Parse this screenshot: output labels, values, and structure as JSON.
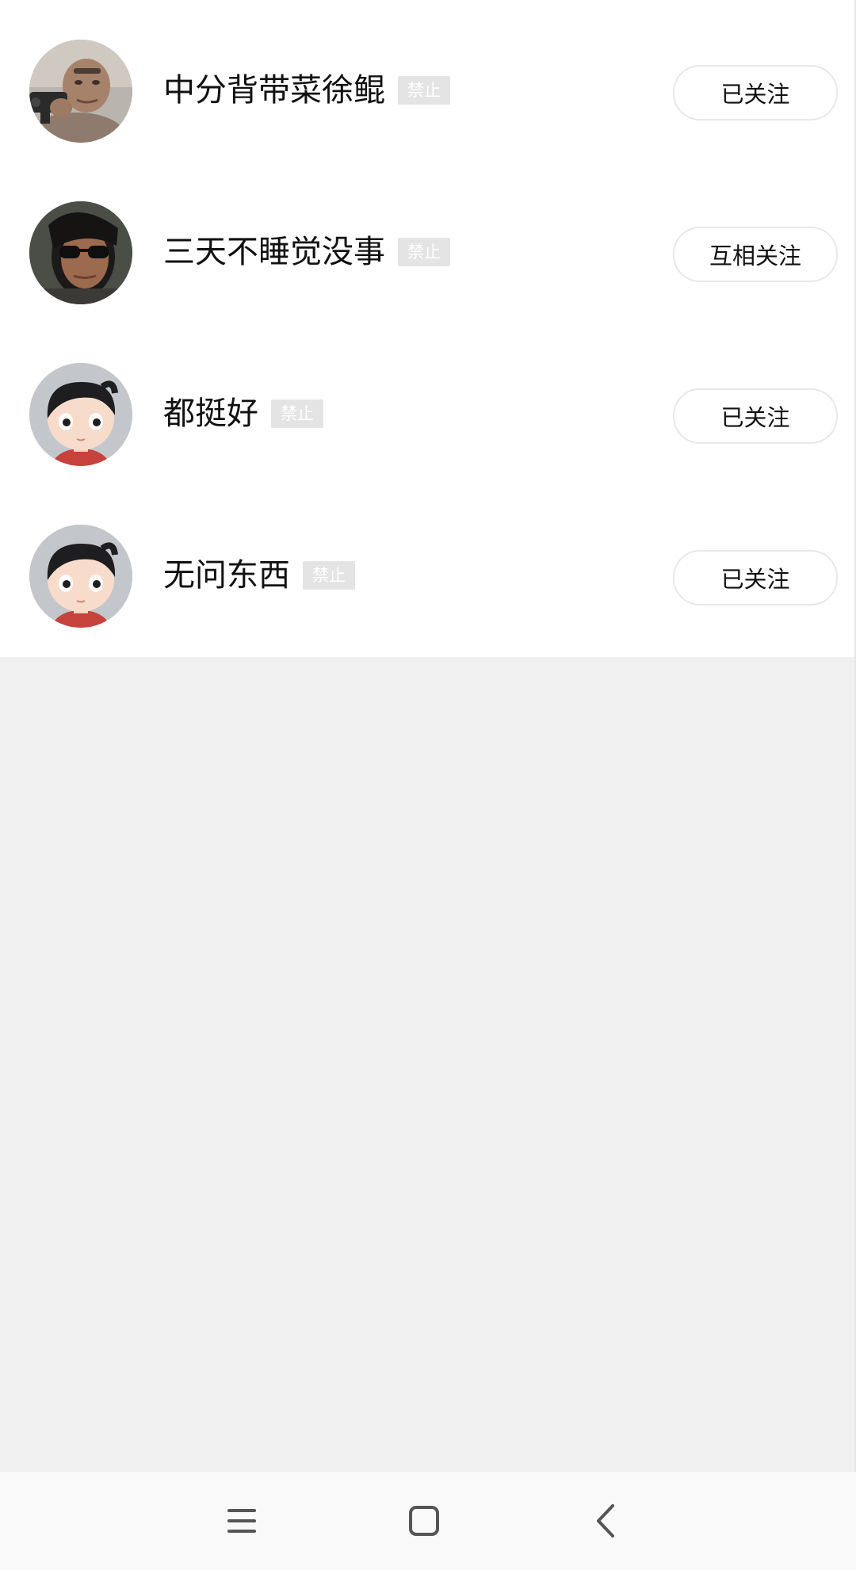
{
  "users": [
    {
      "name": "中分背带菜徐鲲",
      "badge": "禁止",
      "follow_label": "已关注",
      "avatar": "photo-avatar-man-with-gun"
    },
    {
      "name": "三天不睡觉没事",
      "badge": "禁止",
      "follow_label": "互相关注",
      "avatar": "photo-avatar-man-with-sunglasses"
    },
    {
      "name": "都挺好",
      "badge": "禁止",
      "follow_label": "已关注",
      "avatar": "default-cartoon-avatar"
    },
    {
      "name": "无问东西",
      "badge": "禁止",
      "follow_label": "已关注",
      "avatar": "default-cartoon-avatar"
    }
  ],
  "navbar": {
    "icons": [
      "menu-icon",
      "home-square-icon",
      "back-chevron-icon"
    ]
  },
  "colors": {
    "list_background": "#ffffff",
    "page_background": "#f0f0f0",
    "badge_background": "#e4e4e4",
    "button_border": "#e8e8e8"
  }
}
